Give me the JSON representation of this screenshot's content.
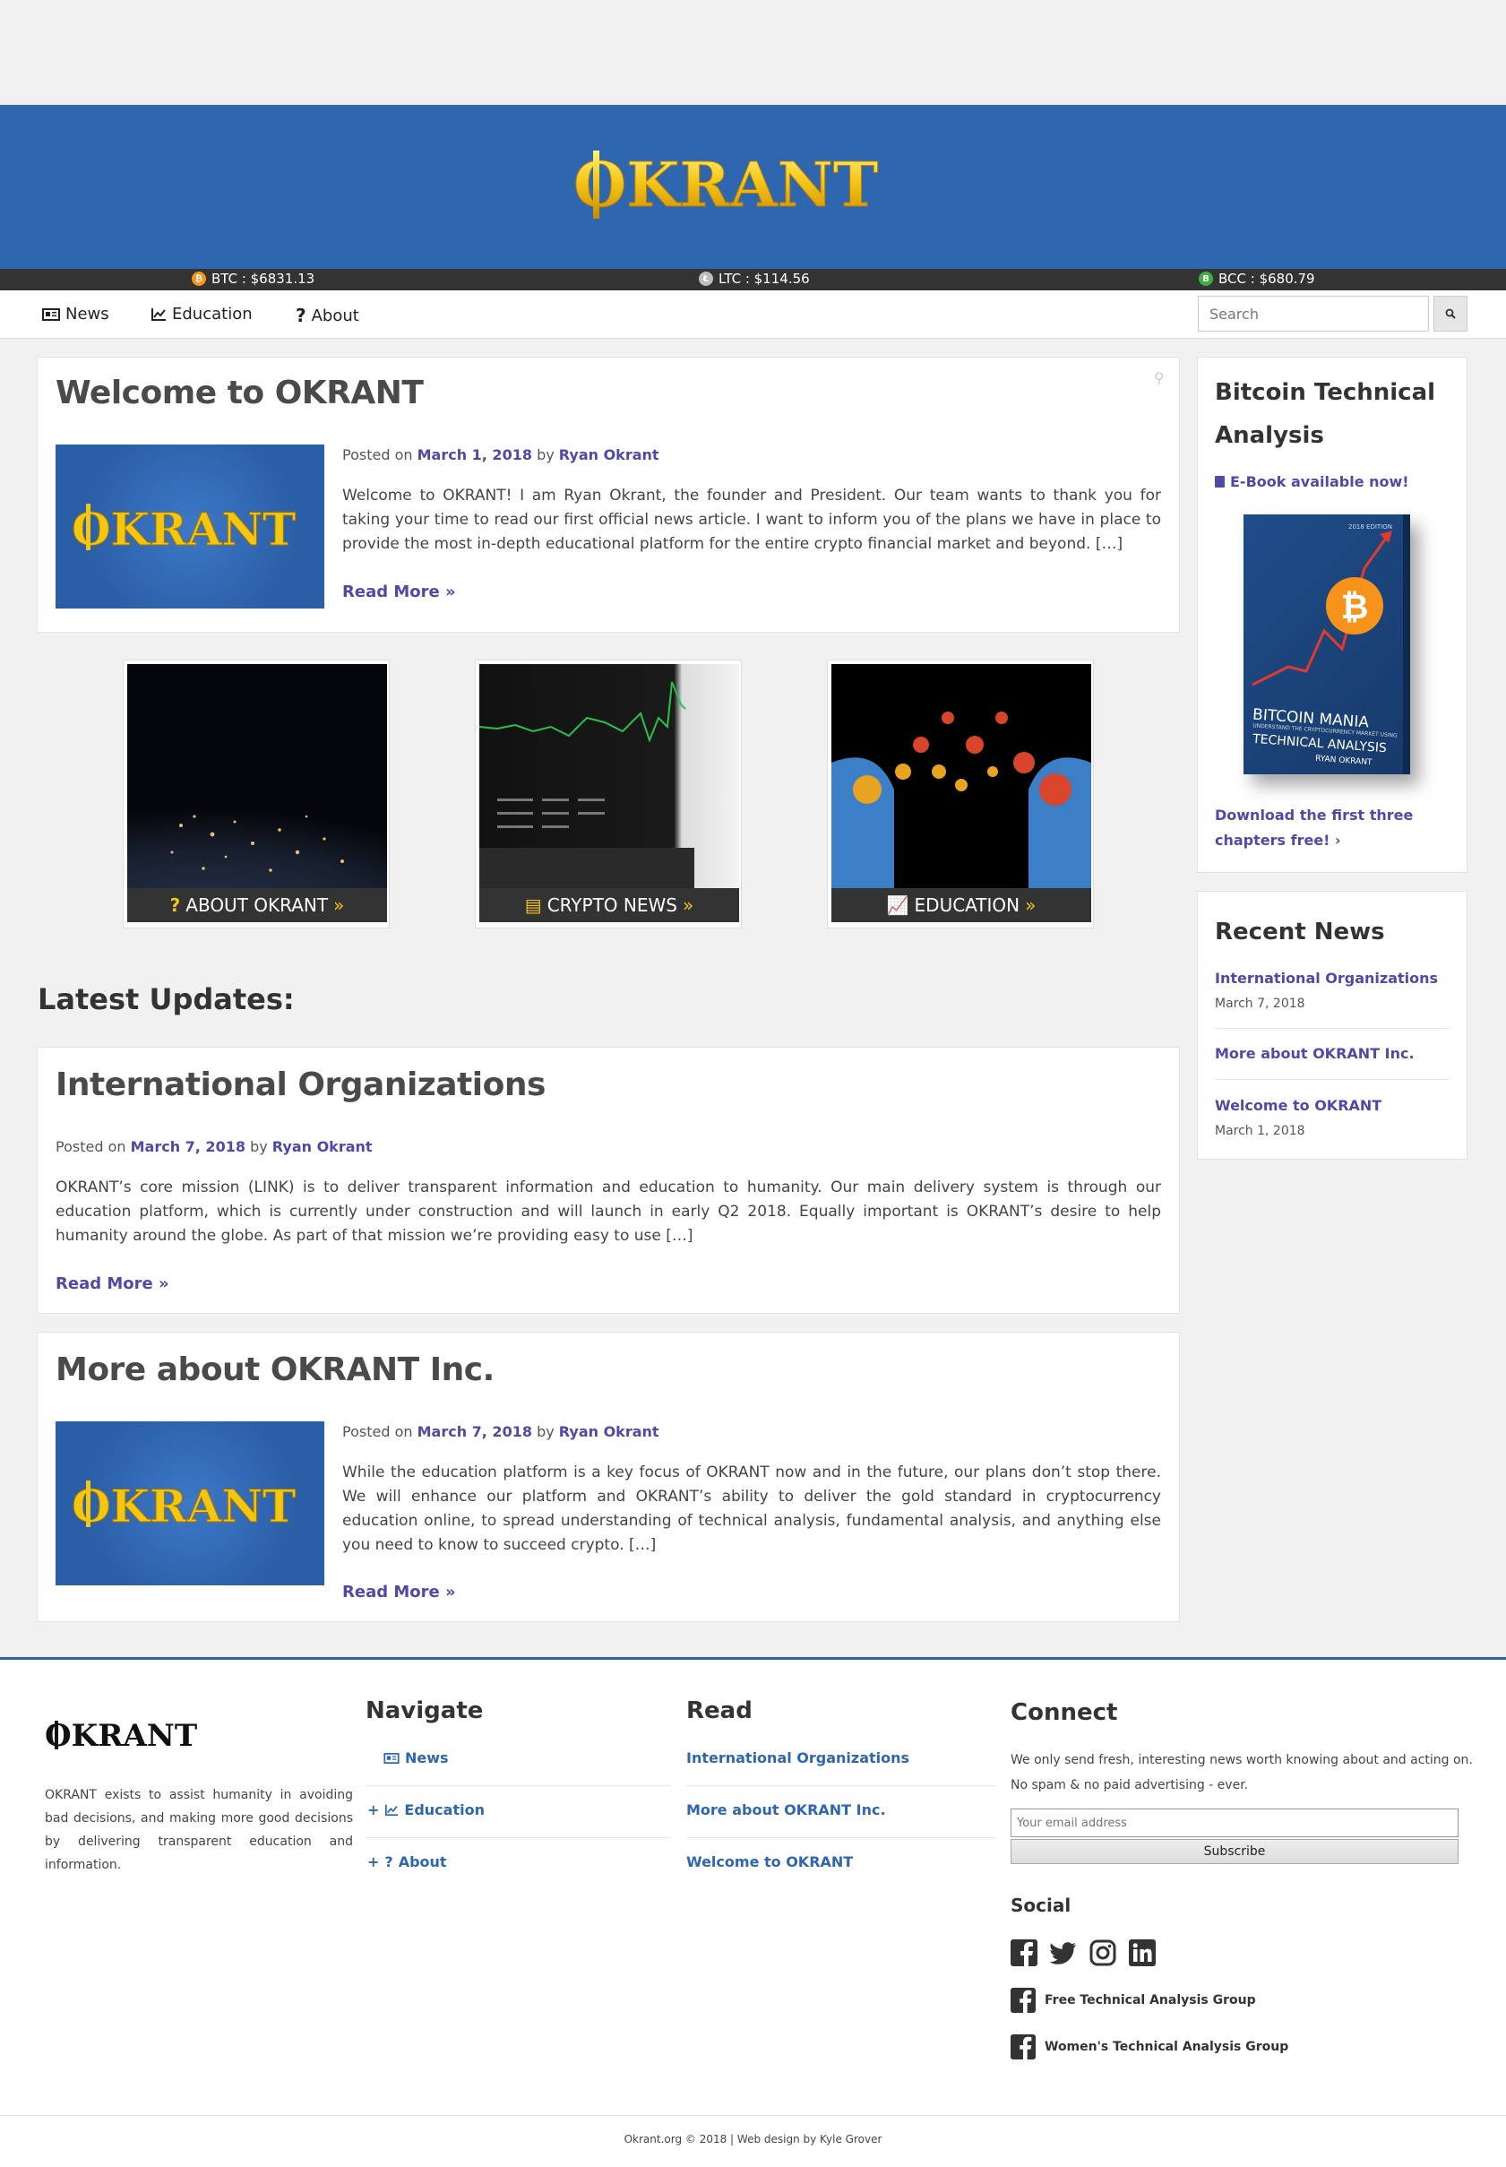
{
  "brand": {
    "name": "OKRANT"
  },
  "ticker": [
    {
      "label": "BTC : $6831.13",
      "icon": "btc-icon",
      "color": "#f7931a"
    },
    {
      "label": "LTC : $114.56",
      "icon": "ltc-icon",
      "color": "#bebebe"
    },
    {
      "label": "BCC : $680.79",
      "icon": "bcc-icon",
      "color": "#3cb043"
    }
  ],
  "nav": {
    "items": [
      {
        "label": "News",
        "icon": "newspaper-icon"
      },
      {
        "label": "Education",
        "icon": "line-chart-icon"
      },
      {
        "label": "About",
        "icon": "question-icon"
      }
    ],
    "search_placeholder": "Search"
  },
  "featured": {
    "title": "Welcome to OKRANT",
    "posted_on": "Posted on",
    "date": "March 1, 2018",
    "by": "by",
    "author": "Ryan Okrant",
    "excerpt": "Welcome to OKRANT! I am Ryan Okrant, the founder and President. Our team wants to thank you for taking your time to read our first official news article. I want to inform you of the plans we have in place to provide the most in-depth educational platform for the entire crypto financial market and beyond. […]",
    "read_more": "Read More »"
  },
  "tiles": [
    {
      "label": "ABOUT OKRANT",
      "icon": "question-icon"
    },
    {
      "label": "CRYPTO NEWS",
      "icon": "newspaper-icon"
    },
    {
      "label": "EDUCATION",
      "icon": "line-chart-icon"
    }
  ],
  "latest": {
    "heading": "Latest Updates:",
    "posts": [
      {
        "title": "International Organizations",
        "posted_on": "Posted on",
        "date": "March 7, 2018",
        "by": "by",
        "author": "Ryan Okrant",
        "excerpt": "OKRANT’s core mission (LINK) is to deliver transparent information and education to humanity. Our main delivery system is through our education platform, which is currently under construction and will launch in early Q2 2018. Equally important is OKRANT’s desire to help humanity around the globe. As part of that mission we’re providing easy to use […]",
        "read_more": "Read More »"
      },
      {
        "title": "More about OKRANT Inc.",
        "posted_on": "Posted on",
        "date": "March 7, 2018",
        "by": "by",
        "author": "Ryan Okrant",
        "excerpt": "While the education platform is a key focus of OKRANT now and in the future, our plans don’t stop there. We will enhance our platform and OKRANT’s ability to deliver the gold standard in cryptocurrency education online, to spread understanding of technical analysis, fundamental analysis, and anything else you need to know to succeed crypto. […]",
        "read_more": "Read More »"
      }
    ]
  },
  "sidebar": {
    "book_heading": "Bitcoin Technical Analysis",
    "ebook_link": "E-Book available now!",
    "book": {
      "edition": "2018 EDITION",
      "title_1": "BITCOIN MANIA",
      "subtitle": "UNDERSTAND THE CRYPTOCURRENCY MARKET USING",
      "title_2": "TECHNICAL ANALYSIS",
      "author": "RYAN OKRANT"
    },
    "download_link": "Download the first three chapters free! ›",
    "recent_heading": "Recent News",
    "recent": [
      {
        "title": "International Organizations",
        "date": "March 7, 2018"
      },
      {
        "title": "More about OKRANT Inc.",
        "date": ""
      },
      {
        "title": "Welcome to OKRANT",
        "date": "March 1, 2018"
      }
    ]
  },
  "footer": {
    "about_text": "OKRANT exists to assist humanity in avoiding bad decisions, and making more good decisions by delivering transparent education and information.",
    "navigate_heading": "Navigate",
    "navigate": [
      {
        "label": "News",
        "icon": "newspaper-icon",
        "prefix": ""
      },
      {
        "label": "Education",
        "icon": "line-chart-icon",
        "prefix": "+"
      },
      {
        "label": "About",
        "icon": "question-icon",
        "prefix": "+"
      }
    ],
    "read_heading": "Read",
    "read": [
      "International Organizations",
      "More about OKRANT Inc.",
      "Welcome to OKRANT"
    ],
    "connect_heading": "Connect",
    "connect_text_1": "We only send fresh, interesting news worth knowing about and acting on.",
    "connect_text_2": "No spam & no paid advertising - ever.",
    "email_placeholder": "Your email address",
    "subscribe_label": "Subscribe",
    "social_heading": "Social",
    "social_icons": [
      "facebook-icon",
      "twitter-icon",
      "instagram-icon",
      "linkedin-icon"
    ],
    "groups": [
      "Free Technical Analysis Group",
      "Women's Technical Analysis Group"
    ],
    "copyright": "Okrant.org © 2018 | Web design by Kyle Grover"
  },
  "colors": {
    "brand_blue": "#2f66b0",
    "link_purple": "#4f4aa8",
    "gold": "#f3c60f"
  }
}
